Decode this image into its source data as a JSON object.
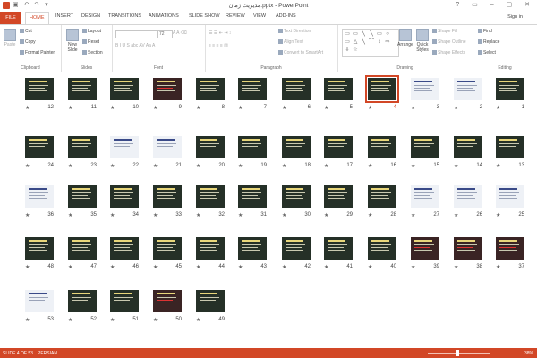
{
  "title": "مدیریت زمان.pptx - PowerPoint",
  "signin": "Sign in",
  "tabs": [
    "FILE",
    "HOME",
    "INSERT",
    "DESIGN",
    "TRANSITIONS",
    "ANIMATIONS",
    "SLIDE SHOW",
    "REVIEW",
    "VIEW",
    "ADD-INS"
  ],
  "ribbon": {
    "clipboard": {
      "label": "Clipboard",
      "paste": "Paste",
      "cut": "Cut",
      "copy": "Copy",
      "format_painter": "Format Painter"
    },
    "slides": {
      "label": "Slides",
      "new_slide": "New Slide",
      "layout": "Layout",
      "reset": "Reset",
      "section": "Section"
    },
    "font": {
      "label": "Font",
      "size": "72"
    },
    "paragraph": {
      "label": "Paragraph",
      "text_direction": "Text Direction",
      "align_text": "Align Text",
      "convert": "Convert to SmartArt"
    },
    "drawing": {
      "label": "Drawing",
      "arrange": "Arrange",
      "quick_styles": "Quick Styles",
      "shape_fill": "Shape Fill",
      "shape_outline": "Shape Outline",
      "shape_effects": "Shape Effects"
    },
    "editing": {
      "label": "Editing",
      "find": "Find",
      "replace": "Replace",
      "select": "Select"
    }
  },
  "slides": {
    "star": "★",
    "selected": 4,
    "rows": [
      [
        "12",
        "11",
        "10",
        "9",
        "8",
        "7",
        "6",
        "5",
        "4",
        "3",
        "2",
        "1"
      ],
      [
        "24",
        "23",
        "22",
        "21",
        "20",
        "19",
        "18",
        "17",
        "16",
        "15",
        "14",
        "13"
      ],
      [
        "36",
        "35",
        "34",
        "33",
        "32",
        "31",
        "30",
        "29",
        "28",
        "27",
        "26",
        "25"
      ],
      [
        "48",
        "47",
        "46",
        "45",
        "44",
        "43",
        "42",
        "41",
        "40",
        "39",
        "38",
        "37"
      ],
      [
        "53",
        "52",
        "51",
        "50",
        "49"
      ]
    ]
  },
  "status": {
    "slide": "SLIDE 4 OF 53",
    "language": "PERSIAN",
    "zoom": "38%"
  },
  "colors": {
    "accent": "#d24726",
    "slide_bg": "#253027"
  }
}
